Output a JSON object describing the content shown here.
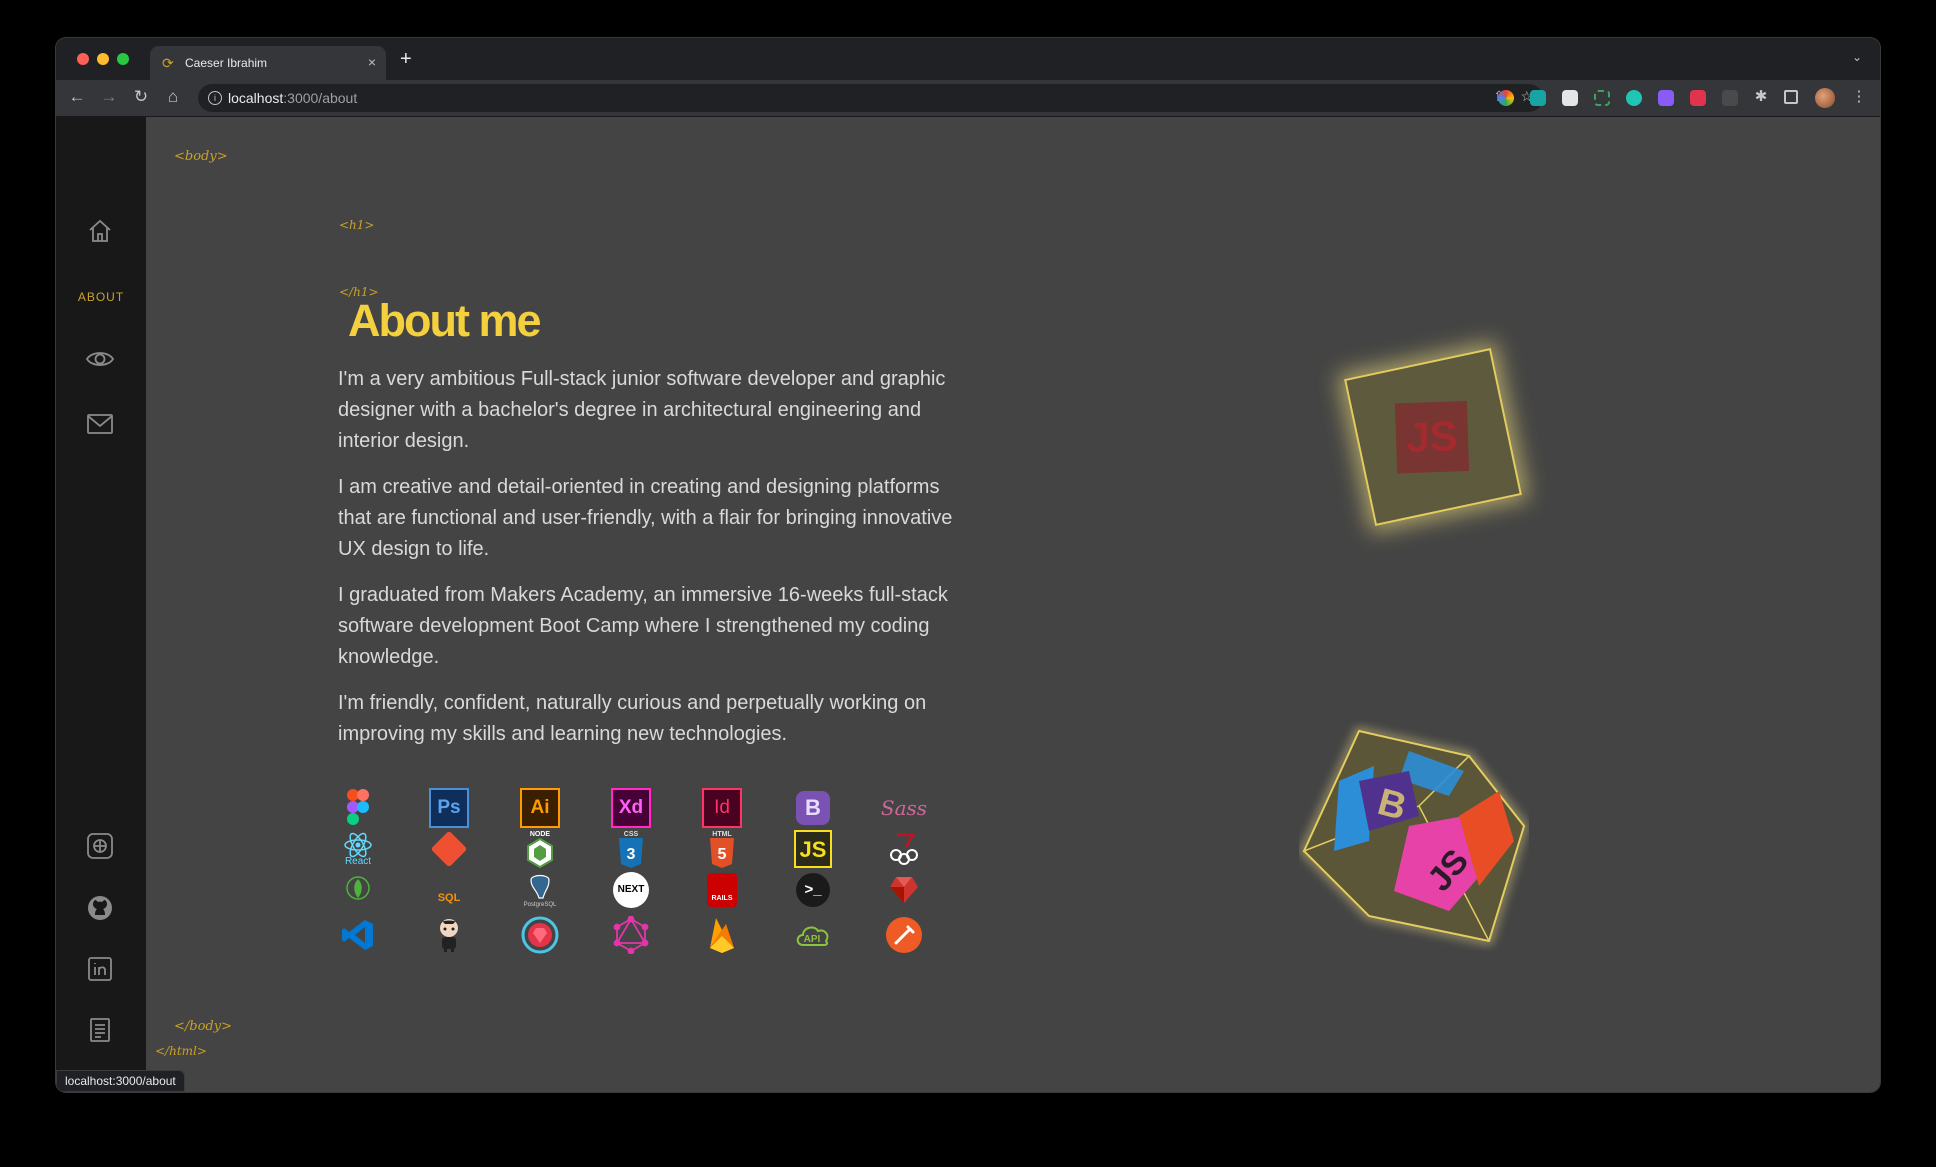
{
  "browser": {
    "tab_title": "Caeser Ibrahim",
    "new_tab": "+",
    "close_tab": "×",
    "url_host": "localhost",
    "url_path": ":3000/about",
    "status_url": "localhost:3000/about"
  },
  "sidebar": {
    "about_label": "ABOUT",
    "nav": [
      "home-icon",
      "eye-icon",
      "mail-icon"
    ],
    "social": [
      "openai-icon",
      "github-icon",
      "linkedin-icon",
      "document-icon"
    ]
  },
  "page": {
    "body_open": "<body>",
    "h1_open": "<h1>",
    "h1_close": "</h1>",
    "title": "About me",
    "body_close": "</body>",
    "html_close": "</html>",
    "paragraphs": [
      "I'm a very ambitious Full-stack junior software developer and graphic designer with a bachelor's degree in architectural engineering and interior design.",
      "I am creative and detail-oriented in creating and designing platforms that are functional and user-friendly, with a flair for bringing innovative UX design to life.",
      "I graduated from Makers Academy, an immersive 16-weeks full-stack software development Boot Camp where I strengthened my coding knowledge.",
      "I'm friendly, confident, naturally curious and perpetually working on improving my skills and learning new technologies."
    ]
  },
  "skills": {
    "ps": "Ps",
    "ai": "Ai",
    "xd": "Xd",
    "id": "Id",
    "bootstrap": "B",
    "sass": "Sass",
    "react": "React",
    "node": "NODE",
    "css3": "CSS",
    "html": "HTML",
    "js": "JS",
    "next": "NEXT",
    "rails": "RAILS",
    "terminal": ">_",
    "api": "API",
    "sql": "SQL",
    "postgres": "PostgreSQL"
  },
  "cube_letters": {
    "front": "B",
    "side": "JS",
    "red": "JS"
  },
  "colors": {
    "accent": "#f4d03f",
    "tag": "#c9a227",
    "background": "#444444",
    "sidebar": "#181818"
  }
}
